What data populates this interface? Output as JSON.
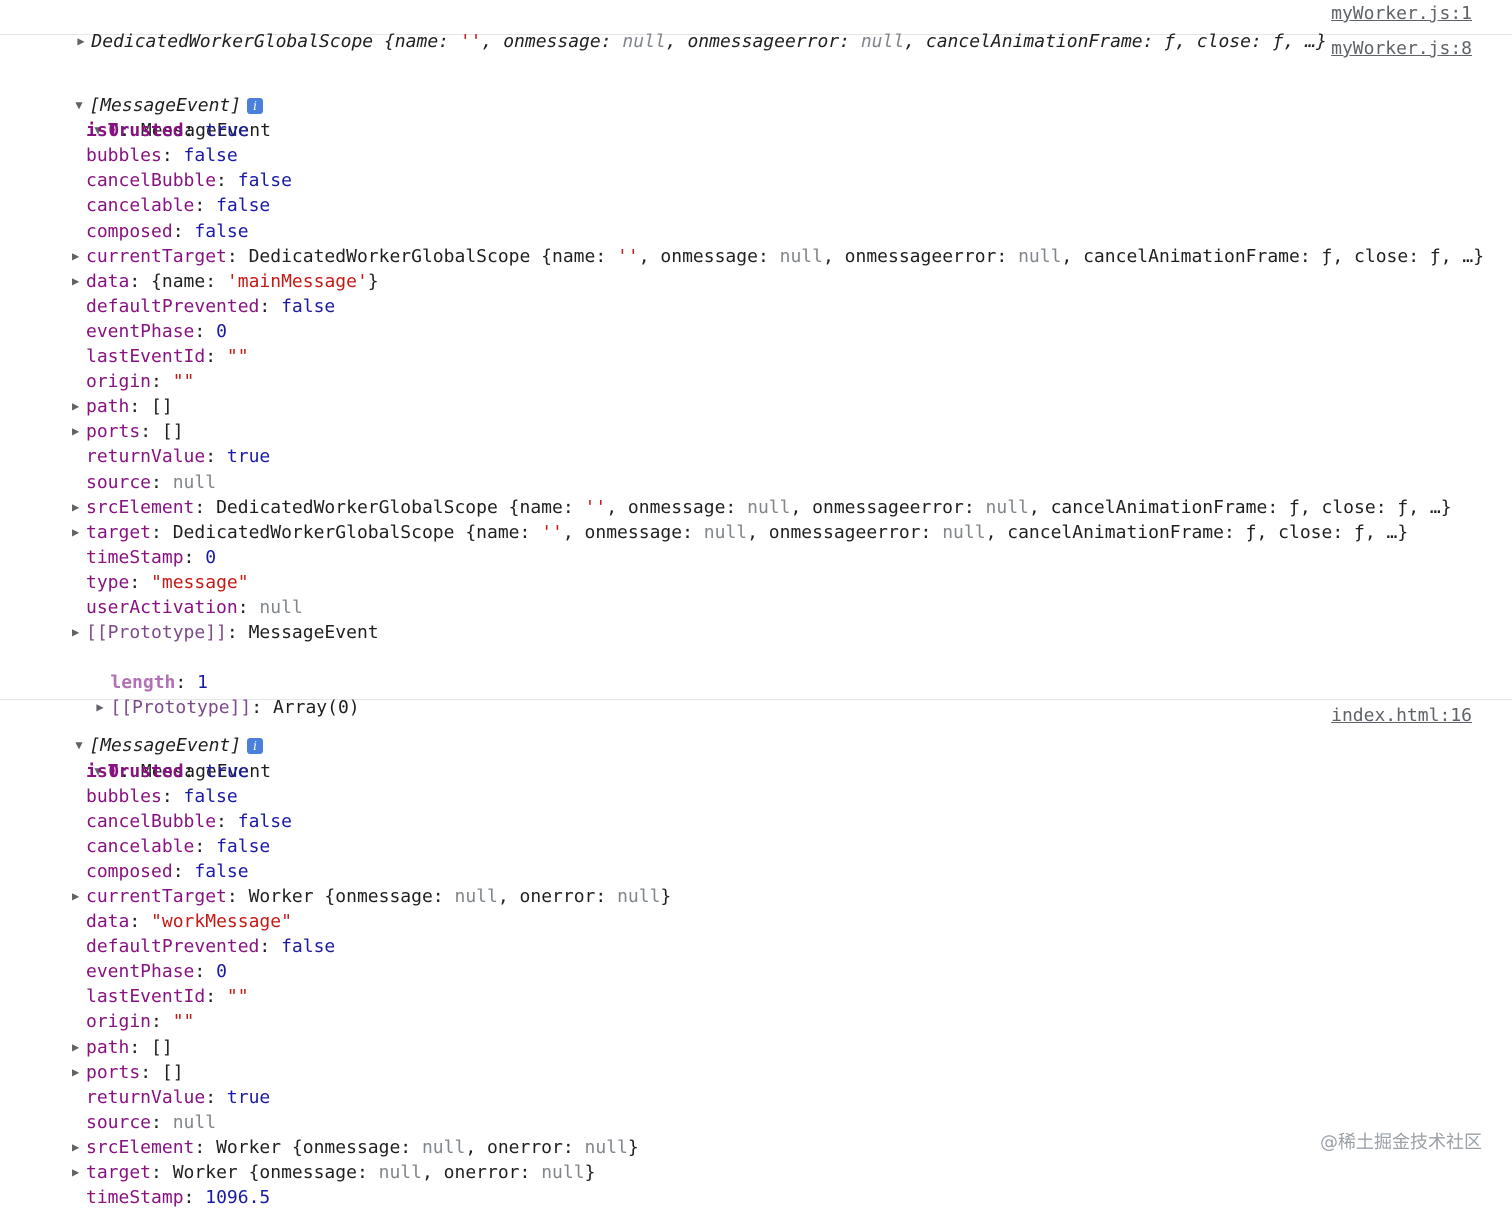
{
  "entry1": {
    "expanded": false,
    "class_name": "DedicatedWorkerGlobalScope",
    "preview": "{name: '', onmessage: null, onmessageerror: null, cancelAnimationFrame: ƒ, close: ƒ, …}",
    "source_link": "myWorker.js:1"
  },
  "entry2": {
    "source_link": "myWorker.js:8",
    "header": "[MessageEvent]",
    "info_icon": "i",
    "item_label": "0",
    "item_type": "MessageEvent",
    "props": [
      {
        "key": "isTrusted",
        "value": "true",
        "value_type": "bool",
        "expandable": false,
        "own": true
      },
      {
        "key": "bubbles",
        "value": "false",
        "value_type": "bool",
        "expandable": false
      },
      {
        "key": "cancelBubble",
        "value": "false",
        "value_type": "bool",
        "expandable": false
      },
      {
        "key": "cancelable",
        "value": "false",
        "value_type": "bool",
        "expandable": false
      },
      {
        "key": "composed",
        "value": "false",
        "value_type": "bool",
        "expandable": false
      },
      {
        "key": "currentTarget",
        "value": "DedicatedWorkerGlobalScope {name: '', onmessage: null, onmessageerror: null, cancelAnimationFrame: ƒ, close: ƒ, …}",
        "value_type": "object",
        "expandable": true
      },
      {
        "key": "data",
        "value": "{name: 'mainMessage'}",
        "value_type": "object",
        "expandable": true
      },
      {
        "key": "defaultPrevented",
        "value": "false",
        "value_type": "bool",
        "expandable": false
      },
      {
        "key": "eventPhase",
        "value": "0",
        "value_type": "number",
        "expandable": false
      },
      {
        "key": "lastEventId",
        "value": "\"\"",
        "value_type": "string",
        "expandable": false
      },
      {
        "key": "origin",
        "value": "\"\"",
        "value_type": "string",
        "expandable": false
      },
      {
        "key": "path",
        "value": "[]",
        "value_type": "object",
        "expandable": true
      },
      {
        "key": "ports",
        "value": "[]",
        "value_type": "object",
        "expandable": true
      },
      {
        "key": "returnValue",
        "value": "true",
        "value_type": "bool",
        "expandable": false
      },
      {
        "key": "source",
        "value": "null",
        "value_type": "null",
        "expandable": false
      },
      {
        "key": "srcElement",
        "value": "DedicatedWorkerGlobalScope {name: '', onmessage: null, onmessageerror: null, cancelAnimationFrame: ƒ, close: ƒ, …}",
        "value_type": "object",
        "expandable": true
      },
      {
        "key": "target",
        "value": "DedicatedWorkerGlobalScope {name: '', onmessage: null, onmessageerror: null, cancelAnimationFrame: ƒ, close: ƒ, …}",
        "value_type": "object",
        "expandable": true
      },
      {
        "key": "timeStamp",
        "value": "0",
        "value_type": "number",
        "expandable": false
      },
      {
        "key": "type",
        "value": "\"message\"",
        "value_type": "string",
        "expandable": false
      },
      {
        "key": "userActivation",
        "value": "null",
        "value_type": "null",
        "expandable": false
      },
      {
        "key": "[[Prototype]]",
        "value": "MessageEvent",
        "value_type": "proto",
        "expandable": true
      }
    ],
    "length_key": "length",
    "length_value": "1",
    "array_proto_key": "[[Prototype]]",
    "array_proto_value": "Array(0)"
  },
  "entry3": {
    "source_link": "index.html:16",
    "header": "[MessageEvent]",
    "info_icon": "i",
    "item_label": "0",
    "item_type": "MessageEvent",
    "props": [
      {
        "key": "isTrusted",
        "value": "true",
        "value_type": "bool",
        "expandable": false,
        "own": true
      },
      {
        "key": "bubbles",
        "value": "false",
        "value_type": "bool",
        "expandable": false
      },
      {
        "key": "cancelBubble",
        "value": "false",
        "value_type": "bool",
        "expandable": false
      },
      {
        "key": "cancelable",
        "value": "false",
        "value_type": "bool",
        "expandable": false
      },
      {
        "key": "composed",
        "value": "false",
        "value_type": "bool",
        "expandable": false
      },
      {
        "key": "currentTarget",
        "value": "Worker {onmessage: null, onerror: null}",
        "value_type": "object",
        "expandable": true
      },
      {
        "key": "data",
        "value": "\"workMessage\"",
        "value_type": "string",
        "expandable": false
      },
      {
        "key": "defaultPrevented",
        "value": "false",
        "value_type": "bool",
        "expandable": false
      },
      {
        "key": "eventPhase",
        "value": "0",
        "value_type": "number",
        "expandable": false
      },
      {
        "key": "lastEventId",
        "value": "\"\"",
        "value_type": "string",
        "expandable": false
      },
      {
        "key": "origin",
        "value": "\"\"",
        "value_type": "string",
        "expandable": false
      },
      {
        "key": "path",
        "value": "[]",
        "value_type": "object",
        "expandable": true
      },
      {
        "key": "ports",
        "value": "[]",
        "value_type": "object",
        "expandable": true
      },
      {
        "key": "returnValue",
        "value": "true",
        "value_type": "bool",
        "expandable": false
      },
      {
        "key": "source",
        "value": "null",
        "value_type": "null",
        "expandable": false
      },
      {
        "key": "srcElement",
        "value": "Worker {onmessage: null, onerror: null}",
        "value_type": "object",
        "expandable": true
      },
      {
        "key": "target",
        "value": "Worker {onmessage: null, onerror: null}",
        "value_type": "object",
        "expandable": true
      },
      {
        "key": "timeStamp",
        "value": "1096.5",
        "value_type": "number",
        "expandable": false
      }
    ]
  },
  "watermark": "@稀土掘金技术社区",
  "colors": {
    "key": "#881280",
    "own_key": "#881280",
    "number_bool": "#1a1aa6",
    "string": "#c41a16",
    "null": "#80868b",
    "info_badge": "#4a7fdc"
  }
}
